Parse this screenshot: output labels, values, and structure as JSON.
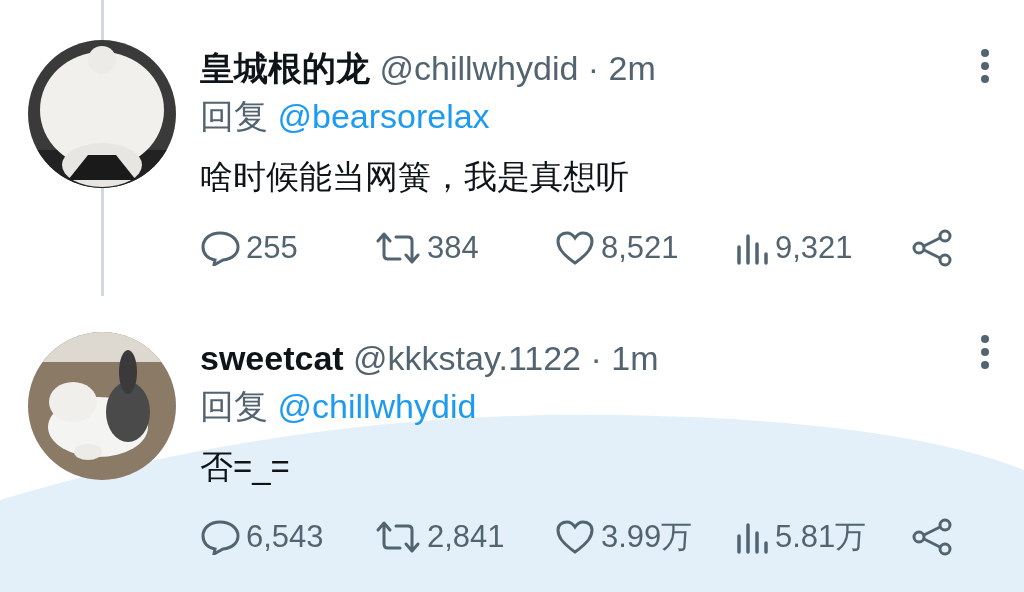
{
  "tweets": [
    {
      "name": "皇城根的龙",
      "handle": "@chillwhydid",
      "time": "· 2m",
      "reply_label": "回复",
      "reply_to": "@bearsorelax",
      "text": "啥时候能当网簧，我是真想听",
      "thread_line": true,
      "stats": {
        "replies": "255",
        "retweets": "384",
        "likes": "8,521",
        "views": "9,321"
      }
    },
    {
      "name": "sweetcat",
      "handle": "@kkkstay.1122",
      "time": "· 1m",
      "reply_label": "回复",
      "reply_to": "@chillwhydid",
      "text": "否=_=",
      "thread_line": false,
      "stats": {
        "replies": "6,543",
        "retweets": "2,841",
        "likes": "3.99万",
        "views": "5.81万"
      }
    }
  ]
}
